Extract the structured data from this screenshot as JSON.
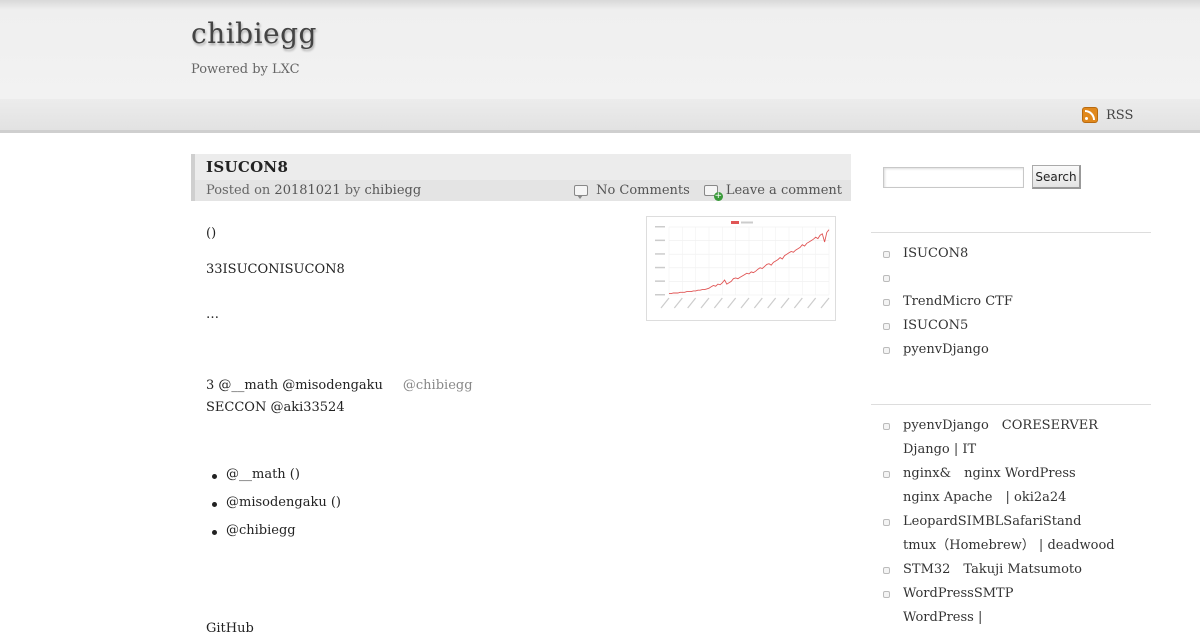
{
  "site": {
    "title": "chibiegg",
    "tagline": "Powered by LXC"
  },
  "nav": {
    "rss_label": "RSS",
    "rss_icon": "rss-feed-icon"
  },
  "post": {
    "title": "ISUCON8",
    "meta_posted_on": "Posted on ",
    "meta_date": "20181021",
    "meta_by": " by ",
    "meta_author": "chibiegg",
    "comments_label": "No Comments",
    "leave_comment_label": "Leave a comment",
    "body": {
      "line1": "()",
      "line2": "33ISUCONISUCON8",
      "line3": "…",
      "line4_main": "3 @__math @misodengaku",
      "line4_muted": "@chibiegg",
      "line5": "SECCON @aki33524",
      "line6": "GitHub"
    },
    "list": [
      "@__math ()",
      "@misodengaku ()",
      "@chibiegg"
    ]
  },
  "thumbnail_chart": {
    "series_color": "#e05555",
    "chart_data": {
      "type": "line",
      "values": [
        2,
        2,
        3,
        3,
        3,
        4,
        4,
        4,
        5,
        5,
        5,
        6,
        6,
        7,
        7,
        8,
        8,
        9,
        10,
        12,
        14,
        13,
        16,
        15,
        18,
        22,
        16,
        18,
        20,
        24,
        25,
        24,
        26,
        28,
        30,
        32,
        31,
        34,
        33,
        35,
        38,
        40,
        39,
        42,
        45,
        46,
        44,
        48,
        50,
        52,
        55,
        53,
        58,
        60,
        62,
        64,
        63,
        66,
        68,
        70,
        74,
        72,
        76,
        78,
        80,
        82,
        85,
        83,
        88,
        90,
        78,
        92,
        96
      ],
      "ylim": [
        0,
        100
      ]
    }
  },
  "sidebar": {
    "search_button": "Search",
    "search_value": "",
    "recent_posts": [
      "ISUCON8",
      "",
      "TrendMicro CTF",
      "ISUCON5",
      "pyenvDjango"
    ],
    "recent_comments": [
      "pyenvDjango　CORESERVER Django | IT",
      "nginx&amp;　nginx WordPress nginx Apache　| oki2a24",
      "LeopardSIMBLSafariStand tmux（Homebrew） | deadwood",
      "STM32　Takuji Matsumoto",
      "WordPressSMTP WordPress |"
    ],
    "recent_comments_lines": [
      [
        "pyenvDjango　CORESERVER",
        "Django | IT"
      ],
      [
        "nginx&　nginx WordPress",
        "nginx Apache　| oki2a24"
      ],
      [
        "LeopardSIMBLSafariStand",
        "tmux（Homebrew） | deadwood"
      ],
      [
        "STM32　Takuji Matsumoto"
      ],
      [
        "WordPressSMTP",
        "WordPress |"
      ]
    ]
  }
}
